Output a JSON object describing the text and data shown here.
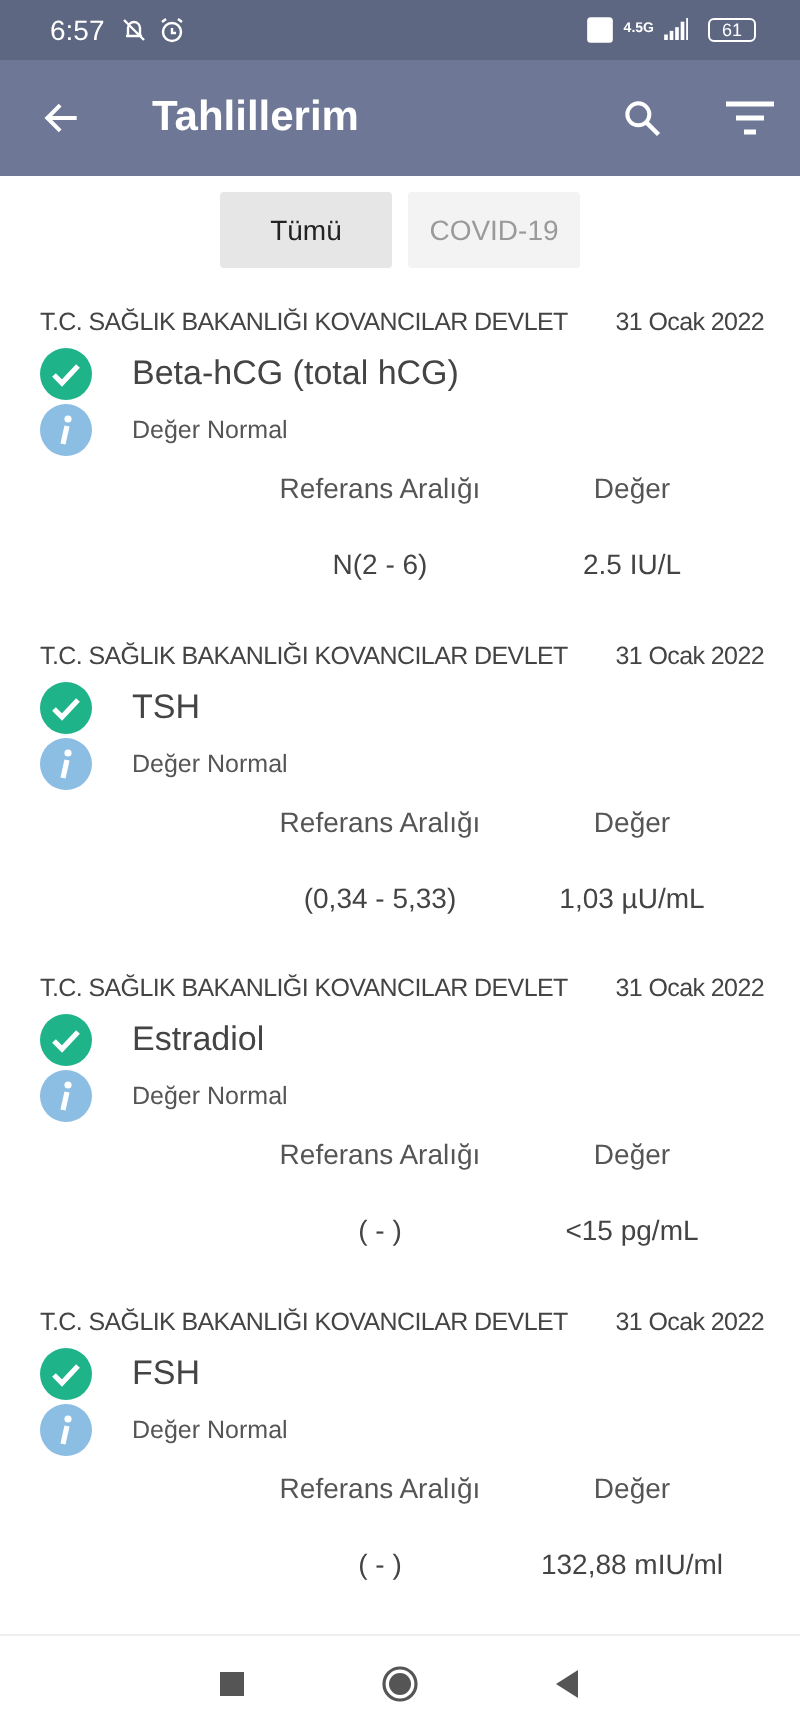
{
  "status_bar": {
    "time": "6:57",
    "network": "4.5G",
    "battery": "61"
  },
  "app_bar": {
    "title": "Tahlillerim"
  },
  "tabs": [
    {
      "label": "Tümü",
      "selected": true
    },
    {
      "label": "COVID-19",
      "selected": false
    }
  ],
  "results": [
    {
      "institution": "T.C. SAĞLIK BAKANLIĞI KOVANCILAR DEVLET",
      "date": "31 Ocak 2022",
      "test": "Beta-hCG (total hCG)",
      "status": "Değer Normal",
      "normal": true,
      "range_label": "Referans Aralığı",
      "value_label": "Değer",
      "range": "N(2 - 6)",
      "value": "2.5 IU/L"
    },
    {
      "institution": "T.C. SAĞLIK BAKANLIĞI KOVANCILAR DEVLET",
      "date": "31 Ocak 2022",
      "test": "TSH",
      "status": "Değer Normal",
      "normal": true,
      "range_label": "Referans Aralığı",
      "value_label": "Değer",
      "range": "(0,34 - 5,33)",
      "value": "1,03 µU/mL"
    },
    {
      "institution": "T.C. SAĞLIK BAKANLIĞI KOVANCILAR DEVLET",
      "date": "31 Ocak 2022",
      "test": "Estradiol",
      "status": "Değer Normal",
      "normal": true,
      "range_label": "Referans Aralığı",
      "value_label": "Değer",
      "range": "( - )",
      "value": "<15 pg/mL"
    },
    {
      "institution": "T.C. SAĞLIK BAKANLIĞI KOVANCILAR DEVLET",
      "date": "31 Ocak 2022",
      "test": "FSH",
      "status": "Değer Normal",
      "normal": true,
      "range_label": "Referans Aralığı",
      "value_label": "Değer",
      "range": "( - )",
      "value": "132,88 mIU/ml"
    }
  ]
}
